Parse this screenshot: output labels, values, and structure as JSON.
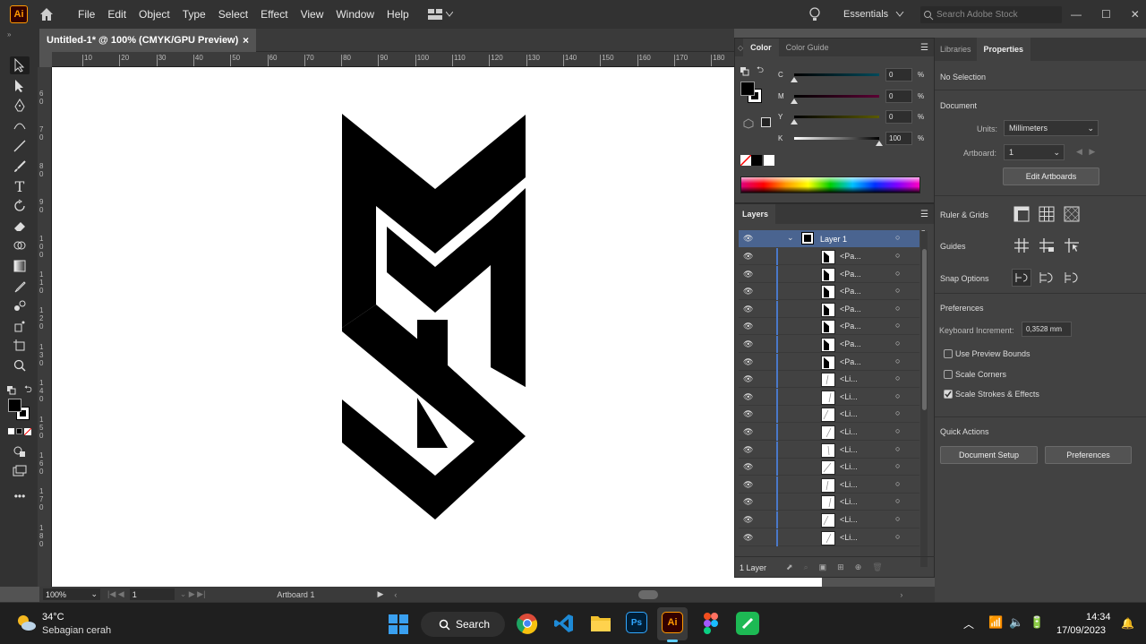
{
  "app": {
    "logo": "Ai"
  },
  "menu": [
    "File",
    "Edit",
    "Object",
    "Type",
    "Select",
    "Effect",
    "View",
    "Window",
    "Help"
  ],
  "topbar": {
    "workspace": "Essentials",
    "search_placeholder": "Search Adobe Stock"
  },
  "document_tab": {
    "title": "Untitled-1* @ 100% (CMYK/GPU Preview)",
    "close": "×"
  },
  "ruler_top": [
    "10",
    "20",
    "30",
    "40",
    "50",
    "60",
    "70",
    "80",
    "90",
    "100",
    "110",
    "120",
    "130",
    "140",
    "150",
    "160",
    "170",
    "180"
  ],
  "ruler_left": [
    "6\n0",
    "7\n0",
    "8\n0",
    "9\n0",
    "1\n0\n0",
    "1\n1\n0",
    "1\n2\n0",
    "1\n3\n0",
    "1\n4\n0",
    "1\n5\n0",
    "1\n6\n0",
    "1\n7\n0",
    "1\n8\n0"
  ],
  "status": {
    "zoom": "100%",
    "artboard_num": "1",
    "artboard_label": "Artboard 1"
  },
  "color_panel": {
    "tabs": [
      "Color",
      "Color Guide"
    ],
    "channels": [
      {
        "name": "C",
        "value": "0"
      },
      {
        "name": "M",
        "value": "0"
      },
      {
        "name": "Y",
        "value": "0"
      },
      {
        "name": "K",
        "value": "100"
      }
    ],
    "levels": [
      0,
      0,
      0,
      100
    ],
    "unit": "%"
  },
  "layers_panel": {
    "title": "Layers",
    "layer_name": "Layer 1",
    "items": [
      "<Pa...",
      "<Pa...",
      "<Pa...",
      "<Pa...",
      "<Pa...",
      "<Pa...",
      "<Pa...",
      "<Li...",
      "<Li...",
      "<Li...",
      "<Li...",
      "<Li...",
      "<Li...",
      "<Li...",
      "<Li...",
      "<Li...",
      "<Li..."
    ],
    "footer": "1 Layer"
  },
  "properties": {
    "tabs": [
      "Libraries",
      "Properties"
    ],
    "selection": "No Selection",
    "document_label": "Document",
    "units_label": "Units:",
    "units_value": "Millimeters",
    "artboard_label": "Artboard:",
    "artboard_value": "1",
    "edit_artboards": "Edit Artboards",
    "ruler_grids": "Ruler & Grids",
    "guides": "Guides",
    "snap_options": "Snap Options",
    "preferences_label": "Preferences",
    "keyboard_increment_label": "Keyboard Increment:",
    "keyboard_increment_value": "0,3528 mm",
    "checkboxes": [
      {
        "label": "Use Preview Bounds",
        "checked": false
      },
      {
        "label": "Scale Corners",
        "checked": false
      },
      {
        "label": "Scale Strokes & Effects",
        "checked": true
      }
    ],
    "quick_actions": "Quick Actions",
    "document_setup": "Document Setup",
    "preferences_button": "Preferences"
  },
  "taskbar": {
    "weather_temp": "34°C",
    "weather_desc": "Sebagian cerah",
    "search": "Search",
    "time": "14:34",
    "date": "17/09/2023",
    "ps_label": "Ps",
    "ai_label": "Ai"
  },
  "colors": {
    "accent_ai": "#ff9a00",
    "panel": "#424242",
    "layer_blue": "#4a78c8"
  }
}
